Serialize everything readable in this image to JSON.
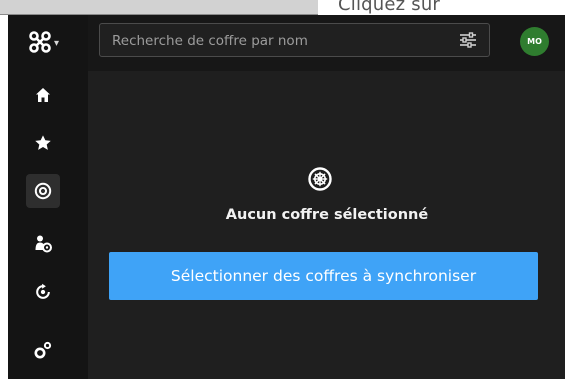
{
  "caption": "Cliquez sur",
  "search": {
    "placeholder": "Recherche de coffre par nom"
  },
  "user": {
    "initials": "MO"
  },
  "sidebar": {
    "items": [
      {
        "icon": "home-icon"
      },
      {
        "icon": "star-icon"
      },
      {
        "icon": "vault-icon",
        "active": true
      },
      {
        "icon": "users-icon"
      },
      {
        "icon": "sync-icon"
      },
      {
        "icon": "settings-icon"
      }
    ]
  },
  "empty_state": {
    "title": "Aucun coffre sélectionné",
    "button_label": "Sélectionner des coffres à synchroniser"
  },
  "colors": {
    "accent": "#3fa3f7",
    "avatar": "#2f7d2f",
    "sidebar_bg": "#141414",
    "main_bg": "#1f1f1f"
  }
}
